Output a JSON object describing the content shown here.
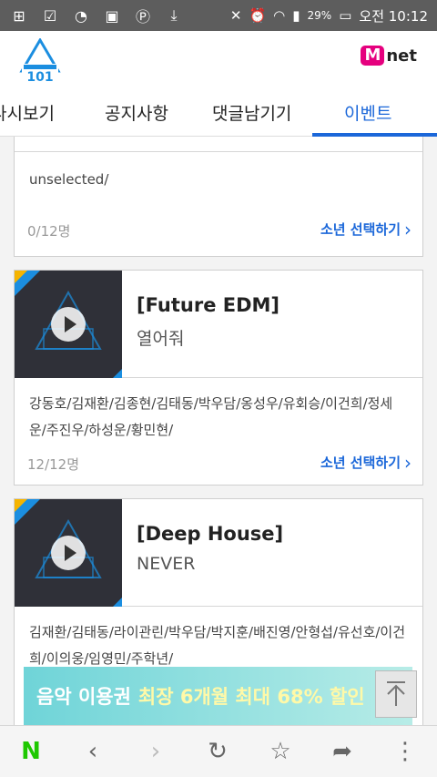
{
  "status_bar": {
    "battery": "29%",
    "time": "오전 10:12"
  },
  "tabs": [
    {
      "label": "다시보기"
    },
    {
      "label": "공지사항"
    },
    {
      "label": "댓글남기기"
    },
    {
      "label": "이벤트"
    }
  ],
  "cards": [
    {
      "members": "unselected/",
      "count": "0/12명",
      "select_label": "소년 선택하기"
    },
    {
      "genre": "[Future EDM]",
      "song": "열어줘",
      "members": "강동호/김재환/김종현/김태동/박우담/옹성우/유회승/이건희/정세운/주진우/하성운/황민현/",
      "count": "12/12명",
      "select_label": "소년 선택하기"
    },
    {
      "genre": "[Deep House]",
      "song": "NEVER",
      "members": "김재환/김태동/라이관린/박우담/박지훈/배진영/안형섭/유선호/이건희/이의웅/임영민/주학년/",
      "count": "",
      "select_label": ""
    }
  ],
  "banner": {
    "text_1": "음악 이용권",
    "text_2": "최장 6개월 최대 68% 할인"
  },
  "brand": {
    "mnet_m": "M",
    "mnet_rest": "net",
    "accent": "#1b67d9",
    "pink": "#e5007e"
  },
  "nav": {
    "n_label": "N"
  }
}
